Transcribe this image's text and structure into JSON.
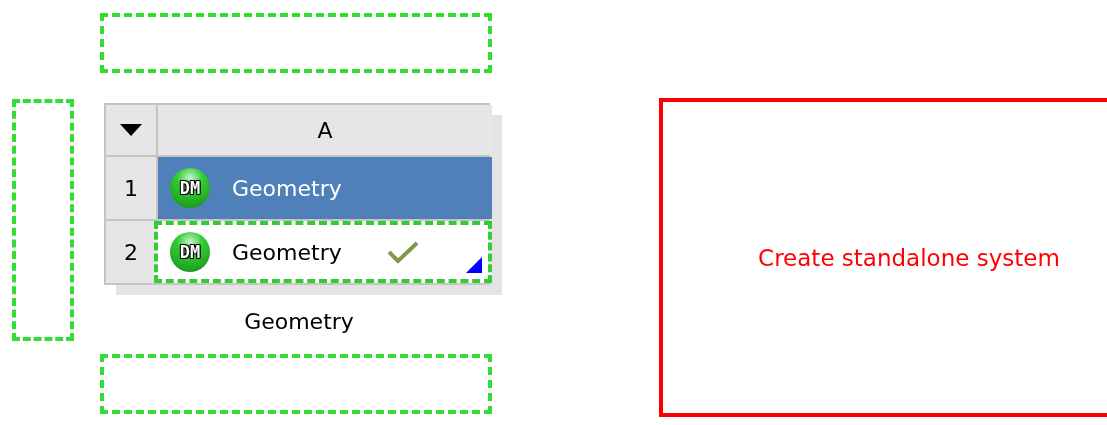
{
  "system": {
    "column_header": "A",
    "caption": "Geometry",
    "rows": [
      {
        "number": "1",
        "icon_text": "DM",
        "label": "Geometry",
        "selected": true,
        "drop_target": false,
        "up_to_date": false
      },
      {
        "number": "2",
        "icon_text": "DM",
        "label": "Geometry",
        "selected": false,
        "drop_target": true,
        "up_to_date": true
      }
    ]
  },
  "standalone_target": {
    "label": "Create standalone system"
  }
}
